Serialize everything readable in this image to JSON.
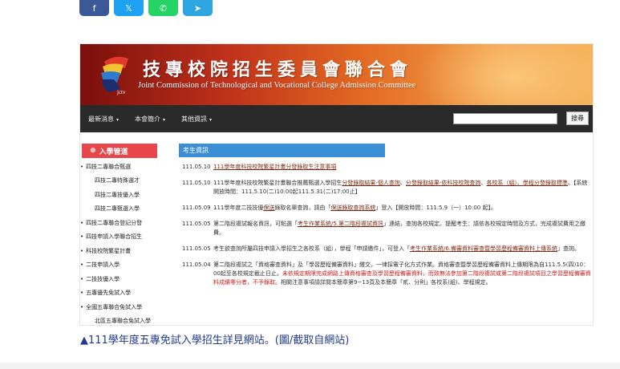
{
  "share": {
    "facebook_icon": "f",
    "x_icon": "𝕏",
    "whatsapp_icon": "✆",
    "telegram_icon": "➤"
  },
  "screenshot": {
    "banner": {
      "title_zh": "技專校院招生委員會聯合會",
      "title_en": "Joint Commission of Technological and Vocational College Admission Committee",
      "logo_text": "jctv"
    },
    "nav": {
      "items": [
        "最新消息",
        "本會簡介",
        "其他資訊"
      ],
      "search_button": "搜尋",
      "search_value": ""
    },
    "sidebar": {
      "heading": "入學管道",
      "items": [
        {
          "label": "四技二專聯合甄選",
          "level": 1
        },
        {
          "label": "四技二專特殊選才",
          "level": 2
        },
        {
          "label": "四技二專技優入學",
          "level": 2
        },
        {
          "label": "四技二專甄選入學",
          "level": 2
        },
        {
          "label": "四技二專聯合登記分發",
          "level": 1
        },
        {
          "label": "四技申請入學聯合招生",
          "level": 1
        },
        {
          "label": "科技校院繁星計畫",
          "level": 1
        },
        {
          "label": "二技申請入學",
          "level": 1
        },
        {
          "label": "二技技優入學",
          "level": 1
        },
        {
          "label": "五專優先免試入學",
          "level": 1
        },
        {
          "label": "全國五專聯合免試入學",
          "level": 1
        },
        {
          "label": "北區五專聯合免試入學",
          "level": 2
        }
      ]
    },
    "content": {
      "tab_title": "考生資訊",
      "news": [
        {
          "date": "111.05.10",
          "parts": [
            {
              "t": "111學年度科技校院繁星計畫分發錄取生注意事項",
              "s": "lnk"
            }
          ]
        },
        {
          "date": "111.05.10",
          "parts": [
            {
              "t": "111學年度科技校院繁星計畫聯合推薦甄選入學招生",
              "s": ""
            },
            {
              "t": "分發錄取結果-個人查詢",
              "s": "lnk"
            },
            {
              "t": "、",
              "s": ""
            },
            {
              "t": "分發錄取結果-依科技校院查詢",
              "s": "lnk"
            },
            {
              "t": "、",
              "s": ""
            },
            {
              "t": "各校系（組）、學程分發錄取標準",
              "s": "lnk"
            },
            {
              "t": "。【系統開放時間：111.5.10(二)10:00起111.5.31(二)17:00止】",
              "s": ""
            }
          ]
        },
        {
          "date": "111.05.09",
          "parts": [
            {
              "t": "111學年度二技技優",
              "s": ""
            },
            {
              "t": "保送",
              "s": "lnk"
            },
            {
              "t": "錄取名單查詢，請由「",
              "s": ""
            },
            {
              "t": "保送錄取查詢系統",
              "s": "lnk"
            },
            {
              "t": "」登入【開放時間：111.5.9（一）10:00 起】。",
              "s": ""
            }
          ]
        },
        {
          "date": "111.05.05",
          "parts": [
            {
              "t": "第二階段複試報名資訊，可點選「",
              "s": ""
            },
            {
              "t": "考生作業系統/5.第二階段複試資訊",
              "s": "lnk"
            },
            {
              "t": "」連結，查詢各校規定。提醒考生：請依各校規定時間及方式，完成複試費用之繳費。",
              "s": ""
            }
          ]
        },
        {
          "date": "111.05.05",
          "parts": [
            {
              "t": "考生欲查詢所屬四技申請入學招生之各校系（組），學程「申請繳件」，可登入「",
              "s": ""
            },
            {
              "t": "考生作業系統/6.備審資料審查暨學習歷程備審資料上傳系統",
              "s": "lnk"
            },
            {
              "t": "」查詢。",
              "s": ""
            }
          ]
        },
        {
          "date": "111.05.04",
          "parts": [
            {
              "t": "第二階段複試之「資格審查資料」及「學習歷程備審資料」繳交，一律採電子化方式作業。資格審查暨學習歷程備審資料上傳期限為自111.5.5(四)10：00起至各校規定截止日止。",
              "s": ""
            },
            {
              "t": "未依規定期限完成網路上傳資格審查及學習歷程備審資料，而致無法參加第二階段複試或第二階段複試項目之學習歷程備審資料成績零分者，不予錄取。",
              "s": "red"
            },
            {
              "t": "相關注意事項請詳閱本簡章第9~13頁及本簡章「貳、分則」各校系(組)、學程規定。",
              "s": ""
            }
          ]
        }
      ]
    }
  },
  "caption": "▲111學年度五專免試入學招生詳見網站。(圖/截取自網站)"
}
